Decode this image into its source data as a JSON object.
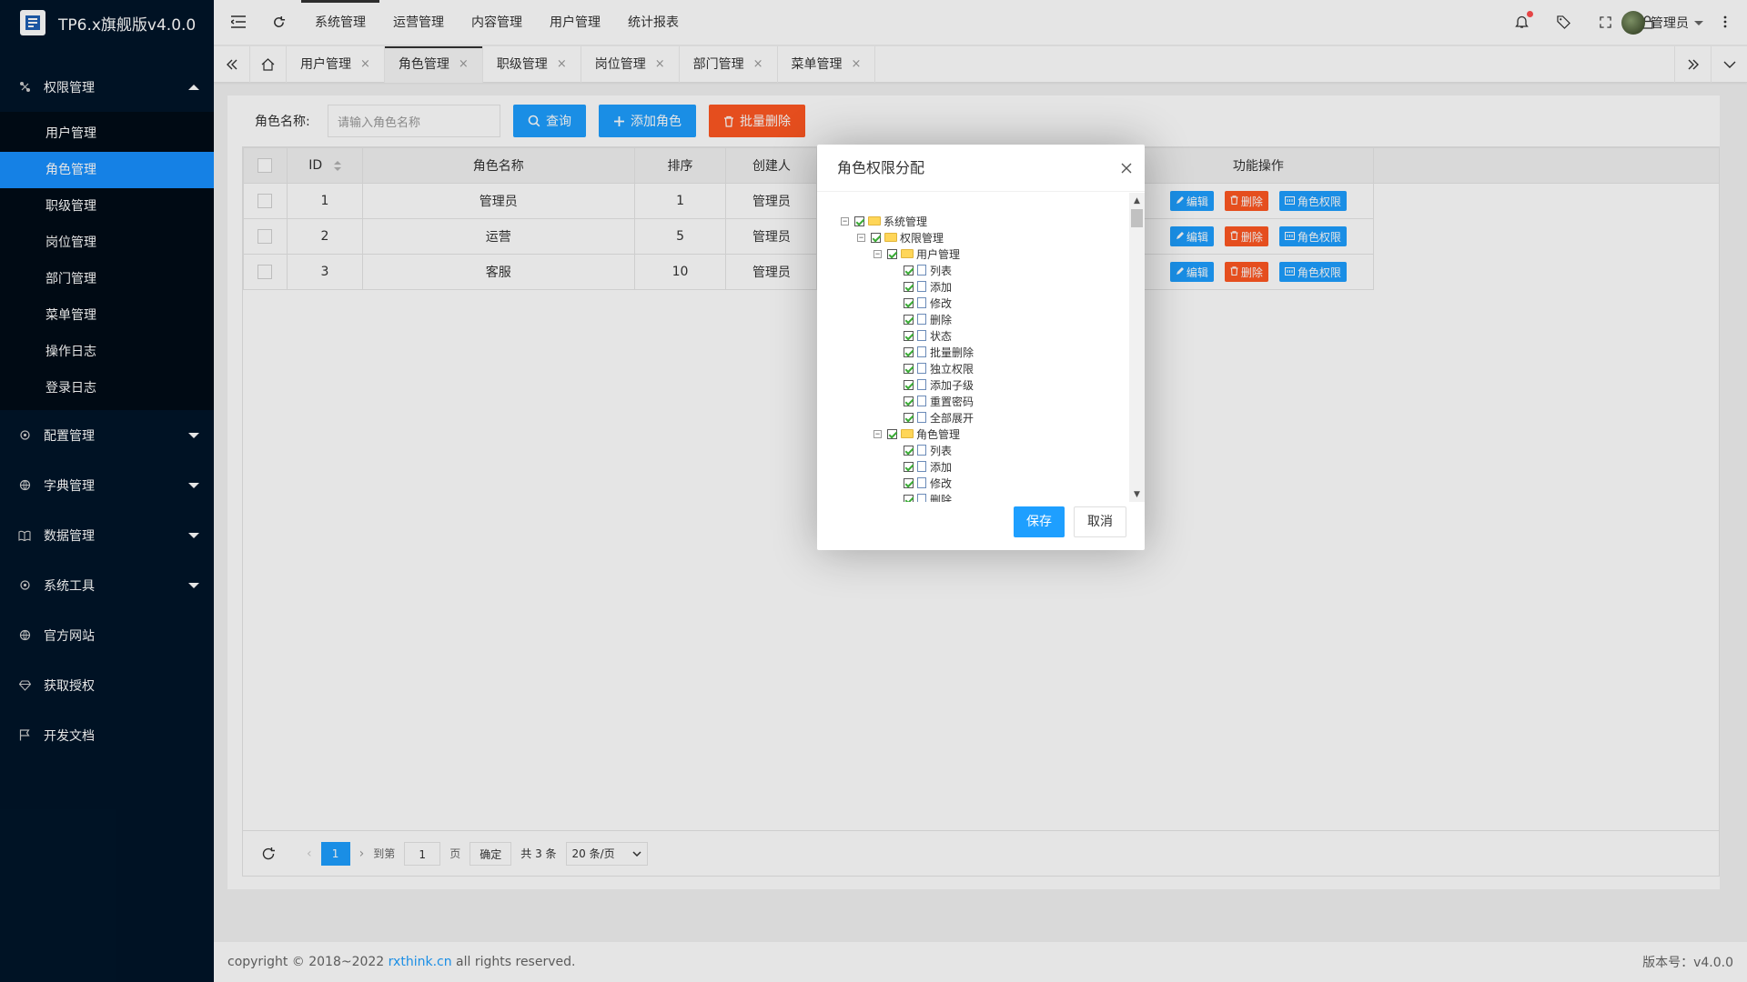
{
  "app": {
    "title": "TP6.x旗舰版v4.0.0"
  },
  "sidebar": {
    "groups": [
      {
        "label": "权限管理",
        "icon": "network-icon",
        "expanded": true,
        "items": [
          "用户管理",
          "角色管理",
          "职级管理",
          "岗位管理",
          "部门管理",
          "菜单管理",
          "操作日志",
          "登录日志"
        ],
        "active": "角色管理"
      },
      {
        "label": "配置管理",
        "icon": "gear-icon"
      },
      {
        "label": "字典管理",
        "icon": "globe-icon"
      },
      {
        "label": "数据管理",
        "icon": "book-icon"
      },
      {
        "label": "系统工具",
        "icon": "gear-icon"
      },
      {
        "label": "官方网站",
        "icon": "globe-icon"
      },
      {
        "label": "获取授权",
        "icon": "diamond-icon"
      },
      {
        "label": "开发文档",
        "icon": "flag-icon"
      }
    ]
  },
  "header": {
    "nav": [
      "系统管理",
      "运营管理",
      "内容管理",
      "用户管理",
      "统计报表"
    ],
    "active_nav": "系统管理",
    "user": "管理员"
  },
  "tabs": [
    {
      "label": "用户管理"
    },
    {
      "label": "角色管理",
      "active": true
    },
    {
      "label": "职级管理"
    },
    {
      "label": "岗位管理"
    },
    {
      "label": "部门管理"
    },
    {
      "label": "菜单管理"
    }
  ],
  "search": {
    "label": "角色名称:",
    "placeholder": "请输入角色名称",
    "query_label": "查询",
    "add_label": "添加角色",
    "batch_delete_label": "批量删除"
  },
  "table": {
    "columns": [
      "ID",
      "角色名称",
      "排序",
      "创建人",
      "功能操作"
    ],
    "rows": [
      {
        "id": "1",
        "name": "管理员",
        "sort": "1",
        "creator": "管理员"
      },
      {
        "id": "2",
        "name": "运营",
        "sort": "5",
        "creator": "管理员"
      },
      {
        "id": "3",
        "name": "客服",
        "sort": "10",
        "creator": "管理员"
      }
    ],
    "actions": {
      "edit": "编辑",
      "delete": "删除",
      "perm": "角色权限"
    }
  },
  "pager": {
    "current": "1",
    "goto_label": "到第",
    "goto_value": "1",
    "page_unit": "页",
    "confirm": "确定",
    "total": "共 3 条",
    "page_size": "20 条/页"
  },
  "modal": {
    "title": "角色权限分配",
    "tree": [
      {
        "level": 0,
        "label": "系统管理",
        "type": "folder"
      },
      {
        "level": 1,
        "label": "权限管理",
        "type": "folder"
      },
      {
        "level": 2,
        "label": "用户管理",
        "type": "folder"
      },
      {
        "level": 3,
        "label": "列表",
        "type": "file"
      },
      {
        "level": 3,
        "label": "添加",
        "type": "file"
      },
      {
        "level": 3,
        "label": "修改",
        "type": "file"
      },
      {
        "level": 3,
        "label": "删除",
        "type": "file"
      },
      {
        "level": 3,
        "label": "状态",
        "type": "file"
      },
      {
        "level": 3,
        "label": "批量删除",
        "type": "file"
      },
      {
        "level": 3,
        "label": "独立权限",
        "type": "file"
      },
      {
        "level": 3,
        "label": "添加子级",
        "type": "file"
      },
      {
        "level": 3,
        "label": "重置密码",
        "type": "file"
      },
      {
        "level": 3,
        "label": "全部展开",
        "type": "file"
      },
      {
        "level": 2,
        "label": "角色管理",
        "type": "folder"
      },
      {
        "level": 3,
        "label": "列表",
        "type": "file"
      },
      {
        "level": 3,
        "label": "添加",
        "type": "file"
      },
      {
        "level": 3,
        "label": "修改",
        "type": "file"
      },
      {
        "level": 3,
        "label": "删除",
        "type": "file"
      }
    ],
    "save": "保存",
    "cancel": "取消"
  },
  "footer": {
    "prefix": "copyright © 2018~2022",
    "link": "rxthink.cn",
    "suffix": "all rights reserved.",
    "version": "版本号：v4.0.0"
  },
  "colors": {
    "primary": "#1e9fff",
    "danger": "#ff5722",
    "sidebar": "#001529",
    "active": "#1890ff"
  }
}
